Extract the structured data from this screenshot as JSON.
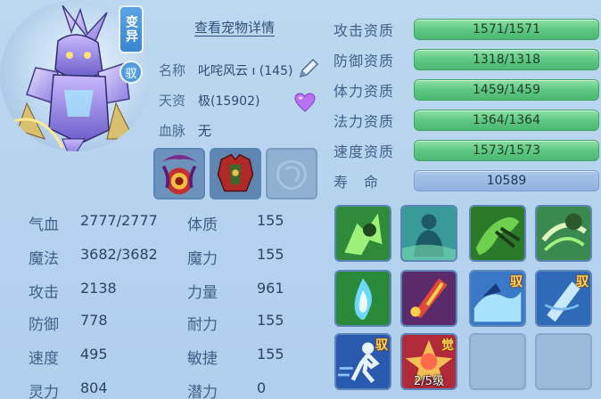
{
  "pet": {
    "variant_tag": "变异",
    "ride_tag": "驭",
    "detail_link": "查看宠物详情",
    "name_label": "名称",
    "name_value": "叱咤风云 ı (145)",
    "talent_label": "天资",
    "talent_value": "极(15902)",
    "bloodline_label": "血脉",
    "bloodline_value": "无"
  },
  "stats": [
    {
      "label": "气血",
      "value": "2777/2777",
      "label2": "体质",
      "value2": "155"
    },
    {
      "label": "魔法",
      "value": "3682/3682",
      "label2": "魔力",
      "value2": "155"
    },
    {
      "label": "攻击",
      "value": "2138",
      "label2": "力量",
      "value2": "961"
    },
    {
      "label": "防御",
      "value": "778",
      "label2": "耐力",
      "value2": "155"
    },
    {
      "label": "速度",
      "value": "495",
      "label2": "敏捷",
      "value2": "155"
    },
    {
      "label": "灵力",
      "value": "804",
      "label2": "潜力",
      "value2": "0"
    }
  ],
  "aptitudes": [
    {
      "label": "攻击资质",
      "value": "1571/1571",
      "fill": 1.0
    },
    {
      "label": "防御资质",
      "value": "1318/1318",
      "fill": 1.0
    },
    {
      "label": "体力资质",
      "value": "1459/1459",
      "fill": 1.0
    },
    {
      "label": "法力资质",
      "value": "1364/1364",
      "fill": 1.0
    },
    {
      "label": "速度资质",
      "value": "1573/1573",
      "fill": 1.0
    },
    {
      "label": "寿　命",
      "value": "10589"
    }
  ],
  "skills": [
    {
      "name": "green-strike-skill-icon"
    },
    {
      "name": "green-figure-skill-icon"
    },
    {
      "name": "green-claw-skill-icon"
    },
    {
      "name": "green-wind-skill-icon"
    },
    {
      "name": "blue-flame-skill-icon"
    },
    {
      "name": "red-sword-skill-icon"
    },
    {
      "name": "blue-splash-skill-icon",
      "badge": "驭"
    },
    {
      "name": "blue-blade-skill-icon",
      "badge": "驭"
    },
    {
      "name": "blue-runner-skill-icon",
      "badge": "驭"
    },
    {
      "name": "red-awaken-skill-icon",
      "badge": "觉",
      "level": "2/5级"
    },
    {
      "name": "empty-skill-slot"
    },
    {
      "name": "empty-skill-slot"
    }
  ]
}
